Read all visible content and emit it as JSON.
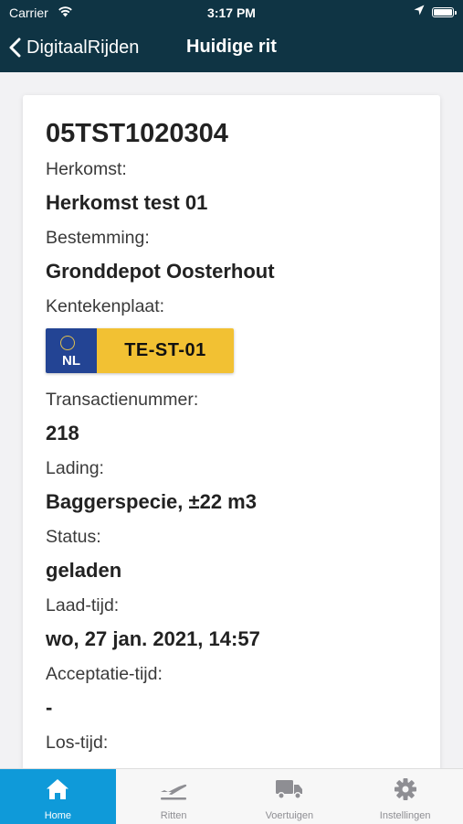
{
  "status_bar": {
    "carrier": "Carrier",
    "time": "3:17 PM"
  },
  "nav": {
    "back_label": "DigitaalRijden",
    "title": "Huidige rit"
  },
  "trip": {
    "id": "05TST1020304",
    "fields": [
      {
        "label": "Herkomst:",
        "value": "Herkomst test 01"
      },
      {
        "label": "Bestemming:",
        "value": "Gronddepot Oosterhout"
      },
      {
        "label": "Kentekenplaat:",
        "plate_country": "NL",
        "plate_number": "TE-ST-01"
      },
      {
        "label": "Transactienummer:",
        "value": "218"
      },
      {
        "label": "Lading:",
        "value": "Baggerspecie, ±22 m3"
      },
      {
        "label": "Status:",
        "value": "geladen"
      },
      {
        "label": "Laad-tijd:",
        "value": "wo, 27 jan. 2021, 14:57"
      },
      {
        "label": "Acceptatie-tijd:",
        "value": "-"
      },
      {
        "label": "Los-tijd:"
      }
    ]
  },
  "tabs": [
    {
      "label": "Home",
      "icon": "home-icon",
      "active": true
    },
    {
      "label": "Ritten",
      "icon": "airplane-icon",
      "active": false
    },
    {
      "label": "Voertuigen",
      "icon": "truck-icon",
      "active": false
    },
    {
      "label": "Instellingen",
      "icon": "gear-icon",
      "active": false
    }
  ],
  "colors": {
    "header": "#0f3444",
    "active_tab": "#0f9ad9",
    "plate_yellow": "#f2c133",
    "plate_blue": "#234494"
  }
}
